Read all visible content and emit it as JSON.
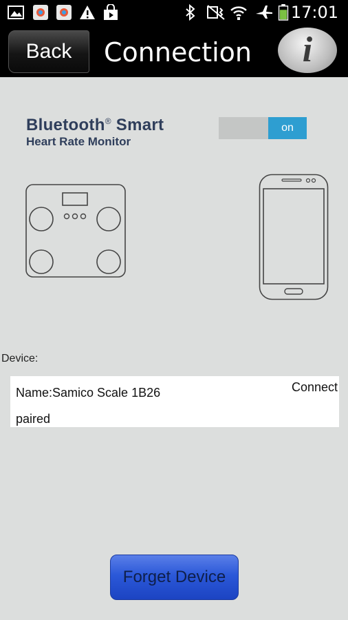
{
  "status_bar": {
    "time": "17:01",
    "icons": [
      "image-icon",
      "app-icon",
      "app-icon",
      "warning-icon",
      "shopping-bag-icon",
      "bluetooth-icon",
      "vibrate-icon",
      "wifi-icon",
      "airplane-icon",
      "battery-icon"
    ],
    "battery_color": "#7bc043"
  },
  "header": {
    "back_label": "Back",
    "title": "Connection",
    "info_label": "i"
  },
  "bluetooth": {
    "title": "Bluetooth",
    "registered": "®",
    "title_suffix": " Smart",
    "subtitle": "Heart Rate Monitor",
    "toggle_label": "on",
    "toggle_state": "on",
    "accent_color": "#2e9ed1"
  },
  "device_section": {
    "label": "Device:",
    "device": {
      "name": "Name:Samico Scale 1B26",
      "status": "paired",
      "action_label": "Connect"
    }
  },
  "footer": {
    "forget_label": "Forget Device"
  }
}
